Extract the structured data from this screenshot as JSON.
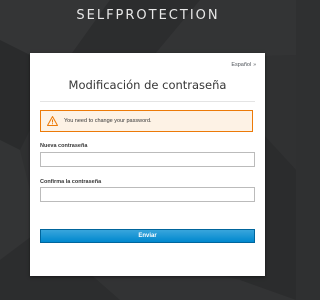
{
  "brand": {
    "title": "SELFPROTECTION"
  },
  "login_card": {
    "language_selector": {
      "label": "Español",
      "caret_icon": "chevron-down-icon"
    },
    "page_title": "Modificación de contraseña",
    "alert": {
      "icon": "warning-icon",
      "message": "You need to change your password.",
      "border_color": "#ec7a08",
      "background_color": "#fdf2e5"
    },
    "new_password": {
      "label": "Nueva contraseña",
      "value": "",
      "placeholder": ""
    },
    "confirm_password": {
      "label": "Confirma la contraseña",
      "value": "",
      "placeholder": ""
    },
    "submit_label": "Enviar"
  },
  "colors": {
    "background": "#2f3031",
    "button": "#0088ce",
    "warning": "#ec7a08"
  }
}
